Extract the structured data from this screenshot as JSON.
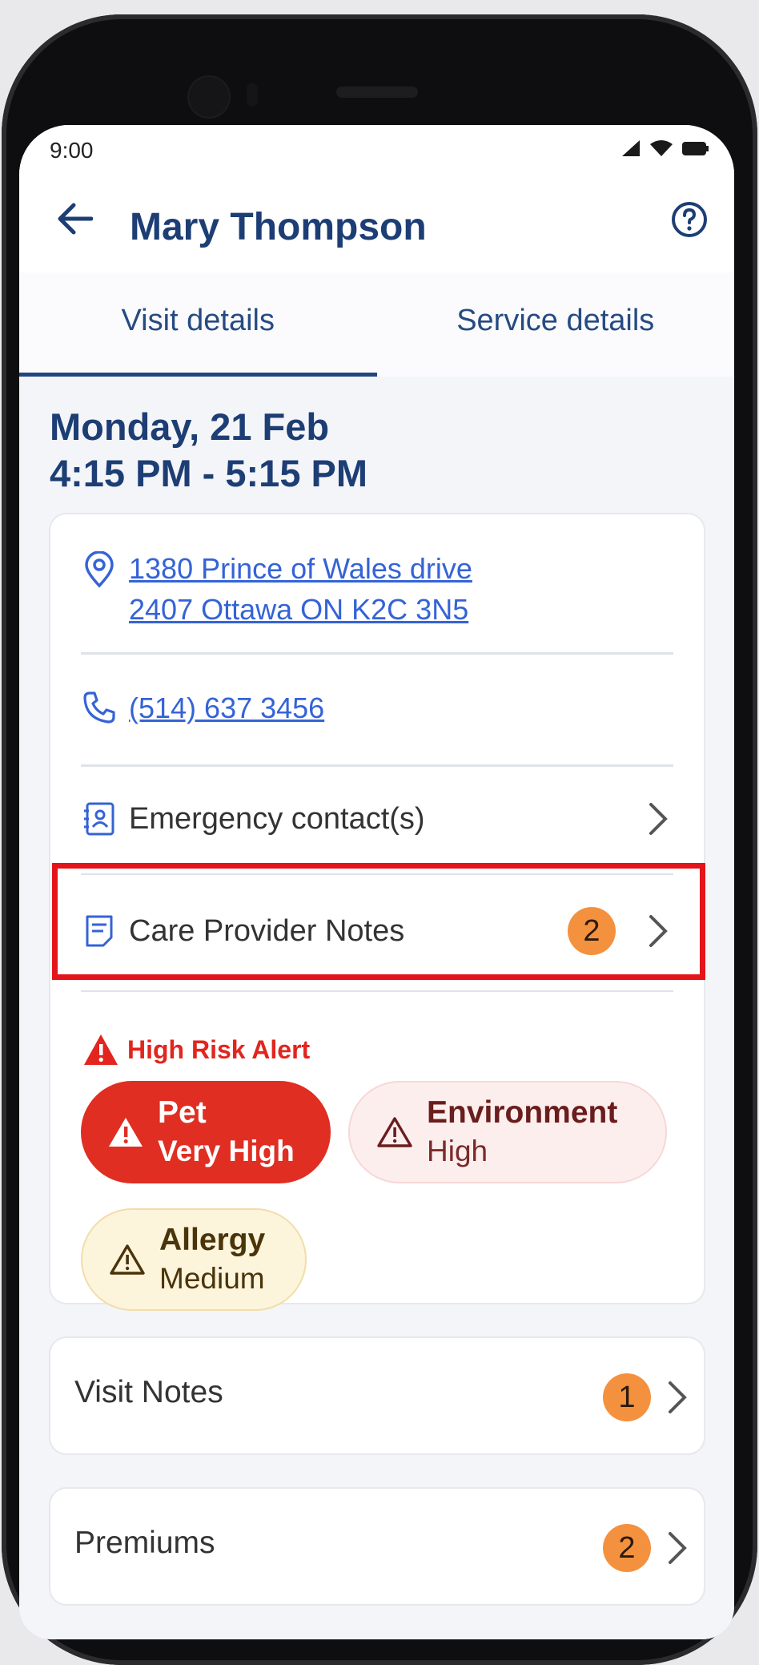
{
  "status_bar": {
    "time": "9:00"
  },
  "app_bar": {
    "title": "Mary Thompson"
  },
  "tabs": [
    {
      "label": "Visit details",
      "active": true
    },
    {
      "label": "Service details",
      "active": false
    }
  ],
  "visit": {
    "date": "Monday, 21 Feb",
    "time_range": "4:15 PM - 5:15 PM"
  },
  "details_card": {
    "address_line1": "1380 Prince of Wales drive",
    "address_line2": "2407 Ottawa ON K2C 3N5",
    "phone": "(514) 637 3456",
    "emergency_label": "Emergency contact(s)",
    "care_notes_label": "Care Provider Notes",
    "care_notes_count": "2",
    "alert_title": "High Risk Alert",
    "risks": [
      {
        "name": "Pet",
        "level": "Very High"
      },
      {
        "name": "Environment",
        "level": "High"
      },
      {
        "name": "Allergy",
        "level": "Medium"
      }
    ]
  },
  "sections": [
    {
      "label": "Visit Notes",
      "count": "1"
    },
    {
      "label": "Premiums",
      "count": "2"
    }
  ],
  "colors": {
    "primary": "#1d3e74",
    "link": "#3563d6",
    "badge": "#f4913f",
    "risk_very_high": "#e02e22",
    "risk_high_bg": "#fdeeee",
    "risk_medium_bg": "#fdf4dc",
    "highlight": "#e4141b"
  }
}
